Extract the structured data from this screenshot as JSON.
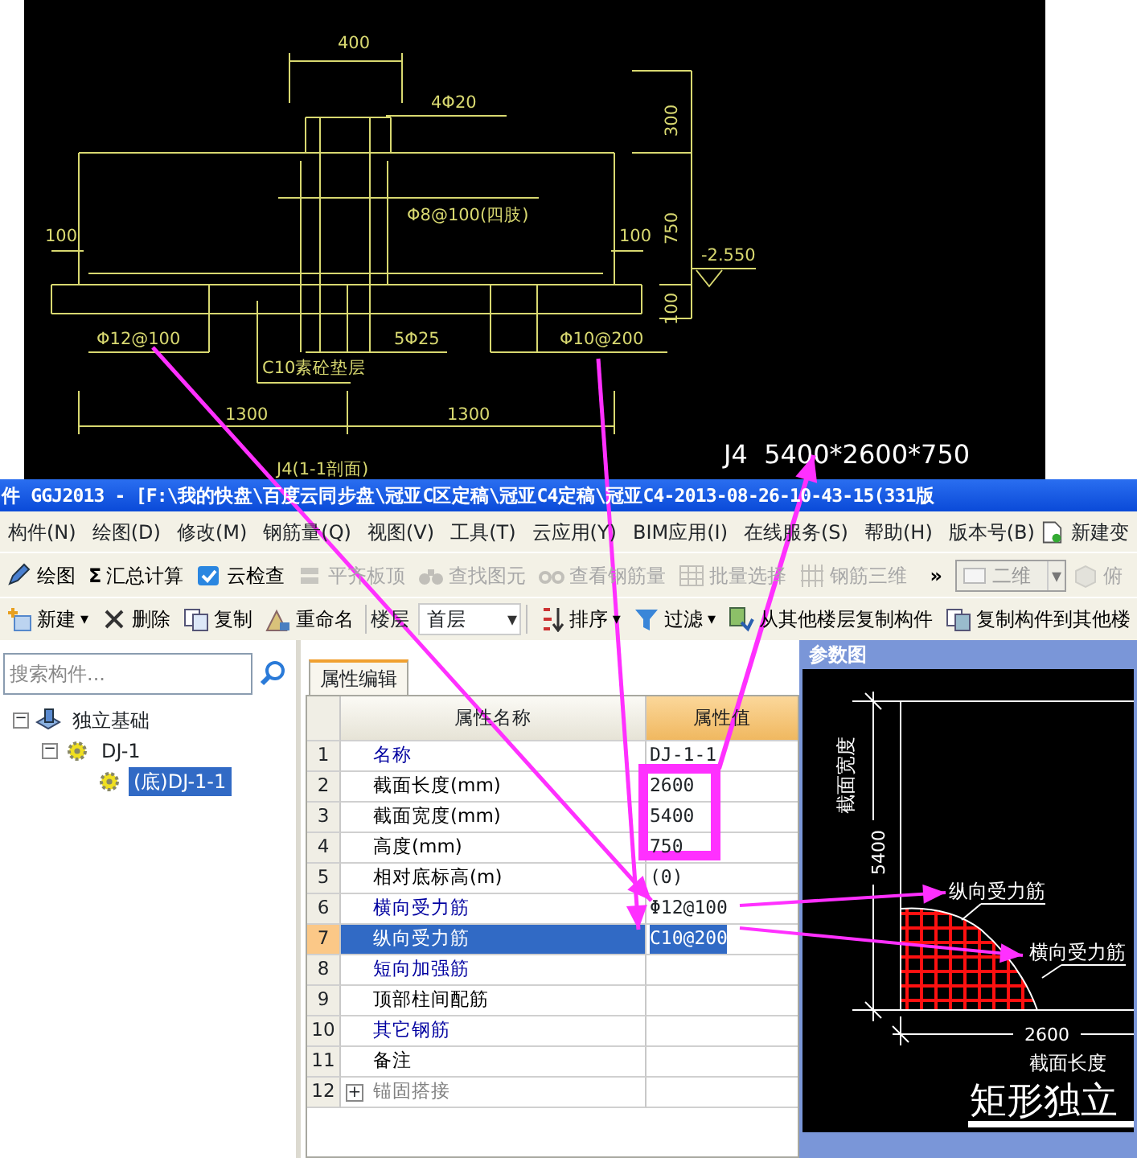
{
  "cad_drawing": {
    "labels": [
      "400",
      "4Φ20",
      "300",
      "Φ8@100(四肢)",
      "100",
      "100",
      "750",
      "-2.550",
      "100",
      "Φ12@100",
      "5Φ25",
      "Φ10@200",
      "C10素砼垫层",
      "1300",
      "1300",
      "J4(1-1剖面)"
    ]
  },
  "callout": "J4  5400*2600*750",
  "window": {
    "title": "件 GGJ2013 - [F:\\我的快盘\\百度云同步盘\\冠亚C区定稿\\冠亚C4定稿\\冠亚C4-2013-08-26-10-43-15(331版"
  },
  "menu": [
    "构件(N)",
    "绘图(D)",
    "修改(M)",
    "钢筋量(Q)",
    "视图(V)",
    "工具(T)",
    "云应用(Y)",
    "BIM应用(I)",
    "在线服务(S)",
    "帮助(H)",
    "版本号(B)",
    "新建变"
  ],
  "toolbar_1": [
    {
      "kind": "button",
      "label": "绘图",
      "disabled": false
    },
    {
      "kind": "button",
      "glyph": "Σ",
      "label": "汇总计算",
      "disabled": false
    },
    {
      "kind": "button",
      "label": "云检查",
      "disabled": false
    },
    {
      "kind": "button",
      "label": "平齐板顶",
      "disabled": true
    },
    {
      "kind": "button",
      "label": "查找图元",
      "disabled": true
    },
    {
      "kind": "button",
      "label": "查看钢筋量",
      "disabled": true
    },
    {
      "kind": "button",
      "label": "批量选择",
      "disabled": true
    },
    {
      "kind": "button",
      "label": "钢筋三维",
      "disabled": true
    },
    {
      "kind": "more",
      "glyph": "»",
      "disabled": false
    },
    {
      "kind": "dropdown",
      "value": "二维",
      "arrow": "▾",
      "disabled": true
    },
    {
      "kind": "button",
      "label": "俯",
      "disabled": true
    }
  ],
  "toolbar_2": [
    {
      "kind": "button",
      "label": "新建",
      "caret": "▾"
    },
    {
      "kind": "button",
      "label": "删除"
    },
    {
      "kind": "button",
      "label": "复制"
    },
    {
      "kind": "button",
      "label": "重命名"
    },
    {
      "kind": "label",
      "label": "楼层"
    },
    {
      "kind": "dropdown",
      "value": "首层",
      "arrow": "▾"
    },
    {
      "kind": "button",
      "label": "排序",
      "caret": "▾"
    },
    {
      "kind": "button",
      "label": "过滤",
      "caret": "▾"
    },
    {
      "kind": "button",
      "label": "从其他楼层复制构件"
    },
    {
      "kind": "button",
      "label": "复制构件到其他楼"
    }
  ],
  "search": {
    "placeholder": "搜索构件..."
  },
  "tree": [
    {
      "label": "独立基础",
      "toggle": "−",
      "expanded": true,
      "selected": false,
      "children": [
        {
          "label": "DJ-1",
          "toggle": "−",
          "expanded": true,
          "selected": false,
          "children": [
            {
              "label": "(底)DJ-1-1",
              "selected": true
            }
          ]
        }
      ]
    }
  ],
  "properties": {
    "tab": "属性编辑",
    "columns": [
      "属性名称",
      "属性值"
    ],
    "rows": [
      {
        "number": "1",
        "name": "名称",
        "value": "DJ-1-1",
        "color": "#0000a0",
        "selected": false
      },
      {
        "number": "2",
        "name": "截面长度(mm)",
        "value": "2600",
        "color": "#000000",
        "selected": false
      },
      {
        "number": "3",
        "name": "截面宽度(mm)",
        "value": "5400",
        "color": "#000000",
        "selected": false
      },
      {
        "number": "4",
        "name": "高度(mm)",
        "value": "750",
        "color": "#000000",
        "selected": false
      },
      {
        "number": "5",
        "name": "相对底标高(m)",
        "value": "(0)",
        "color": "#000000",
        "selected": false
      },
      {
        "number": "6",
        "name": "横向受力筋",
        "value": "Φ12@100",
        "color": "#0000a0",
        "selected": false
      },
      {
        "number": "7",
        "name": "纵向受力筋",
        "value": "C10@200",
        "selected": true
      },
      {
        "number": "8",
        "name": "短向加强筋",
        "color": "#0000a0",
        "selected": false
      },
      {
        "number": "9",
        "name": "顶部柱间配筋",
        "color": "#000000",
        "selected": false
      },
      {
        "number": "10",
        "name": "其它钢筋",
        "color": "#0000a0",
        "selected": false
      },
      {
        "number": "11",
        "name": "备注",
        "color": "#000000",
        "selected": false
      },
      {
        "number": "12",
        "expander": "+",
        "name": "锚固搭接",
        "color": "#808080",
        "selected": false
      }
    ]
  },
  "param_figure": {
    "title": "参数图",
    "labels": [
      "截面宽度",
      "5400",
      "纵向受力筋",
      "横向受力筋",
      "2600",
      "截面长度",
      "矩形独立"
    ]
  }
}
